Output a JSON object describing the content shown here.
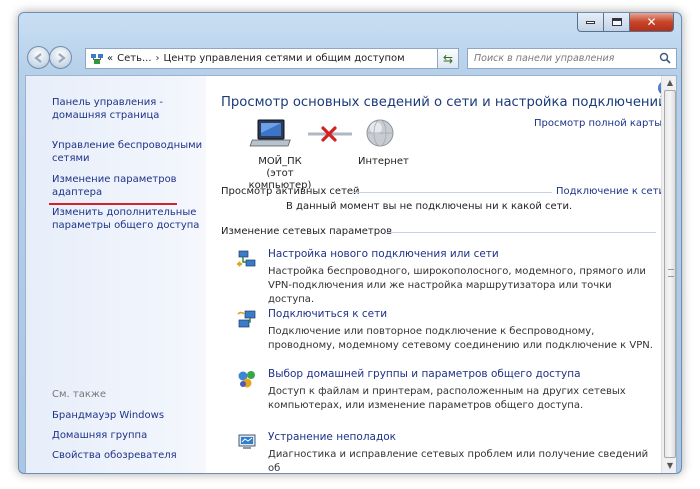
{
  "window": {
    "minimize_icon": "minimize-icon",
    "maximize_icon": "maximize-icon",
    "close_glyph": "✕"
  },
  "address_bar": {
    "crumbs": [
      "Сеть...",
      "Центр управления сетями и общим доступом"
    ],
    "separator": "›",
    "prefix": "«"
  },
  "search": {
    "placeholder": "Поиск в панели управления"
  },
  "sidebar": {
    "links": [
      {
        "line1": "Панель управления -",
        "line2": "домашняя страница"
      },
      {
        "line1": "Управление беспроводными",
        "line2": "сетями"
      },
      {
        "line1": "Изменение параметров",
        "line2": "адаптера"
      },
      {
        "line1": "Изменить дополнительные",
        "line2": "параметры общего доступа"
      }
    ],
    "see_also_title": "См. также",
    "see_also": [
      "Брандмауэр Windows",
      "Домашняя группа",
      "Свойства обозревателя"
    ]
  },
  "main": {
    "title": "Просмотр основных сведений о сети и настройка подключений",
    "full_map_link": "Просмотр полной карты",
    "computer_name": "МОЙ_ПК",
    "computer_sub": "(этот компьютер)",
    "internet_label": "Интернет",
    "active_networks_head": "Просмотр активных сетей",
    "connect_link": "Подключение к сети",
    "no_network_text": "В данный момент вы не подключены ни к какой сети.",
    "change_settings_head": "Изменение сетевых параметров",
    "tasks": [
      {
        "icon": "network-setup-icon",
        "link": "Настройка нового подключения или сети",
        "desc": "Настройка беспроводного, широкополосного, модемного, прямого или VPN-подключения или же настройка маршрутизатора или точки доступа."
      },
      {
        "icon": "connect-network-icon",
        "link": "Подключиться к сети",
        "desc": "Подключение или повторное подключение к беспроводному, проводному, модемному сетевому соединению или подключение к VPN."
      },
      {
        "icon": "homegroup-icon",
        "link": "Выбор домашней группы и параметров общего доступа",
        "desc": "Доступ к файлам и принтерам, расположенным на других сетевых компьютерах, или изменение параметров общего доступа."
      },
      {
        "icon": "troubleshoot-icon",
        "link": "Устранение неполадок",
        "desc": "Диагностика и исправление сетевых проблем или получение сведений об"
      }
    ]
  },
  "colors": {
    "link": "#1e3287",
    "title": "#1b3a7a",
    "annotation_line": "#d8202a",
    "disconnect_x": "#d32020"
  }
}
